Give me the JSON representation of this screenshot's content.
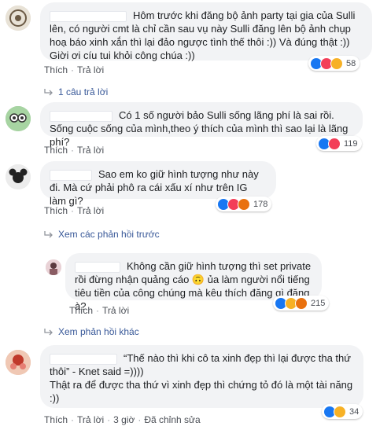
{
  "comments": [
    {
      "text": "Hôm trước khi đăng bộ ảnh party tại gia của Sulli lên, có người cmt là chỉ cần sau vụ này Sulli đăng lên bộ ảnh chụp hoạ báo xinh xắn thì lại đảo ngược tình thế thôi :)) Và đúng thật :)) Giời ơi cíu tui khỏi công chúa :))",
      "like_label": "Thích",
      "reply_label": "Trả lời",
      "reaction_count": "58"
    },
    {
      "text": "Có 1 số người bảo Sulli sống lãng phí là sai rồi. Sống cuộc sống của mình,theo ý thích của mình thì sao lại là lãng phí?",
      "like_label": "Thích",
      "reply_label": "Trả lời",
      "reaction_count": "119"
    },
    {
      "text": "Sao em ko giữ hình tượng như này đi. Mà cứ phải phô ra cái xấu xí như trên IG làm gì?",
      "like_label": "Thích",
      "reply_label": "Trả lời",
      "reaction_count": "178"
    },
    {
      "text": "Không cần giữ hình tượng thì set private rồi đừng nhận quảng cáo 🙃 ủa làm người nổi tiếng tiêu tiền của công chúng mà kêu thích đăng gì đăng à?",
      "like_label": "Thích",
      "reply_label": "Trả lời",
      "reaction_count": "215"
    },
    {
      "text": "“Thế nào thì khi cô ta xinh đẹp thì lại được tha thứ thôi” - Knet said =))))\nThật ra để được tha thứ vì xinh đẹp thì chứng tỏ đó là một tài năng :))",
      "like_label": "Thích",
      "reply_label": "Trả lời",
      "time": "3 giờ",
      "edited": "Đã chỉnh sửa",
      "reaction_count": "34"
    }
  ],
  "replies_link": "1 câu trả lời",
  "prev_replies": "Xem các phản hồi trước",
  "more_replies": "Xem phản hồi khác"
}
